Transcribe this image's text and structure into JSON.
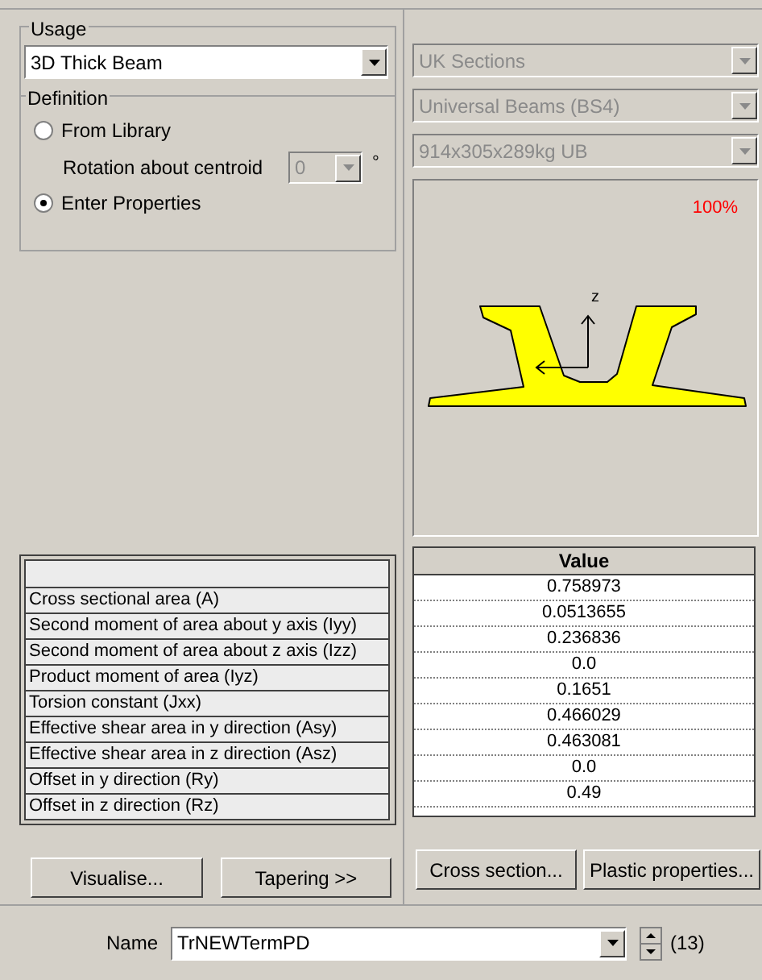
{
  "usage": {
    "label": "Usage",
    "value": "3D Thick Beam"
  },
  "definition": {
    "label": "Definition",
    "options": [
      {
        "label": "From Library",
        "selected": false
      },
      {
        "label": "Enter Properties",
        "selected": true
      }
    ],
    "rotation": {
      "label": "Rotation about centroid",
      "value": "0",
      "unit": "°",
      "disabled": true
    }
  },
  "library": [
    {
      "value": "UK Sections",
      "disabled": true
    },
    {
      "value": "Universal Beams (BS4)",
      "disabled": true
    },
    {
      "value": "914x305x289kg UB",
      "disabled": true
    }
  ],
  "preview": {
    "zoom": "100%",
    "axis_label": "z"
  },
  "properties": {
    "value_header": "Value",
    "rows": [
      {
        "name": "Cross sectional area (A)",
        "value": "0.758973"
      },
      {
        "name": "Second moment of area about y axis (Iyy)",
        "value": "0.0513655"
      },
      {
        "name": "Second moment of area about z axis (Izz)",
        "value": "0.236836"
      },
      {
        "name": "Product moment of area (Iyz)",
        "value": "0.0"
      },
      {
        "name": "Torsion constant (Jxx)",
        "value": "0.1651"
      },
      {
        "name": "Effective shear area in y direction (Asy)",
        "value": "0.466029"
      },
      {
        "name": "Effective shear area in z direction (Asz)",
        "value": "0.463081"
      },
      {
        "name": "Offset in y direction (Ry)",
        "value": "0.0"
      },
      {
        "name": "Offset in z direction (Rz)",
        "value": "0.49"
      }
    ]
  },
  "left_buttons": [
    "Visualise...",
    "Tapering >>"
  ],
  "right_buttons": [
    "Cross section...",
    "Plastic properties..."
  ],
  "name_field": {
    "label": "Name",
    "value": "TrNEWTermPD",
    "count": "(13)"
  }
}
